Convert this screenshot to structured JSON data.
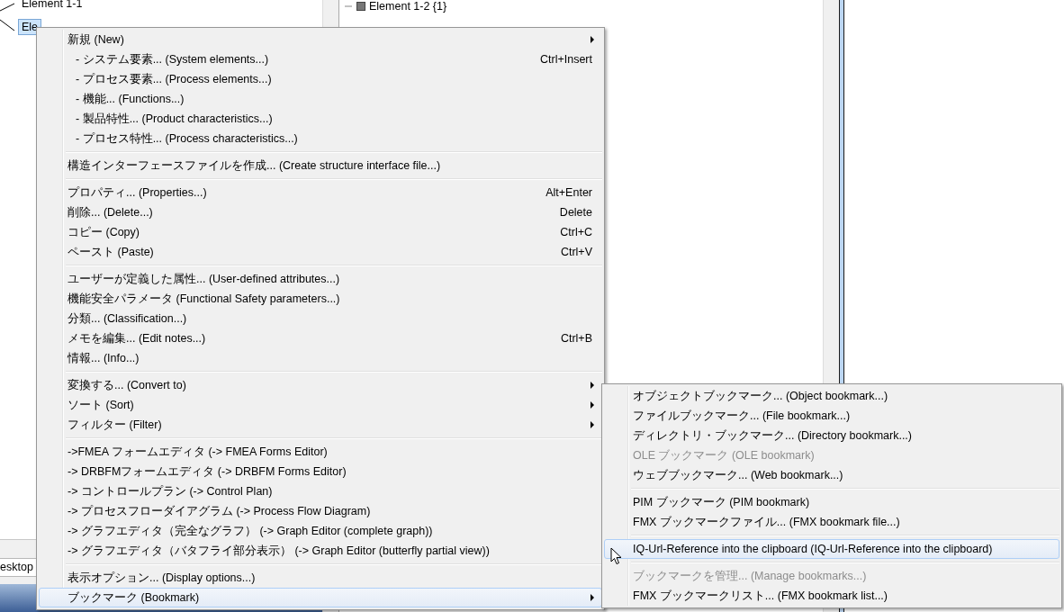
{
  "tree": {
    "items": [
      {
        "label": "Element 1-1",
        "selected": false
      },
      {
        "label": "Ele",
        "selected": true
      }
    ]
  },
  "detail": {
    "items": [
      {
        "label": "Element 1-2 {1}",
        "expanded": true
      }
    ]
  },
  "bottom_tab": {
    "label": "esktop"
  },
  "context_menu": {
    "items": [
      {
        "kind": "item",
        "label": "新規 (New)",
        "has_submenu": true,
        "disabled": false,
        "selected": false
      },
      {
        "kind": "subitem",
        "label": "- システム要素... (System elements...)",
        "shortcut": "Ctrl+Insert",
        "has_submenu": false,
        "disabled": false,
        "selected": false
      },
      {
        "kind": "subitem",
        "label": "- プロセス要素... (Process elements...)",
        "has_submenu": false,
        "disabled": false,
        "selected": false
      },
      {
        "kind": "subitem",
        "label": "- 機能... (Functions...)",
        "has_submenu": false,
        "disabled": false,
        "selected": false
      },
      {
        "kind": "subitem",
        "label": "- 製品特性... (Product characteristics...)",
        "has_submenu": false,
        "disabled": false,
        "selected": false
      },
      {
        "kind": "subitem",
        "label": "- プロセス特性... (Process characteristics...)",
        "has_submenu": false,
        "disabled": false,
        "selected": false
      },
      {
        "kind": "separator"
      },
      {
        "kind": "item",
        "label": "構造インターフェースファイルを作成... (Create structure interface file...)",
        "has_submenu": false,
        "disabled": false,
        "selected": false
      },
      {
        "kind": "separator"
      },
      {
        "kind": "item",
        "label": "プロパティ... (Properties...)",
        "shortcut": "Alt+Enter",
        "has_submenu": false,
        "disabled": false,
        "selected": false
      },
      {
        "kind": "item",
        "label": "削除... (Delete...)",
        "shortcut": "Delete",
        "has_submenu": false,
        "disabled": false,
        "selected": false
      },
      {
        "kind": "item",
        "label": "コピー (Copy)",
        "shortcut": "Ctrl+C",
        "has_submenu": false,
        "disabled": false,
        "selected": false
      },
      {
        "kind": "item",
        "label": "ペースト (Paste)",
        "shortcut": "Ctrl+V",
        "has_submenu": false,
        "disabled": false,
        "selected": false
      },
      {
        "kind": "separator"
      },
      {
        "kind": "item",
        "label": "ユーザーが定義した属性... (User-defined attributes...)",
        "has_submenu": false,
        "disabled": false,
        "selected": false
      },
      {
        "kind": "item",
        "label": "機能安全パラメータ (Functional Safety parameters...)",
        "has_submenu": false,
        "disabled": false,
        "selected": false
      },
      {
        "kind": "item",
        "label": "分類... (Classification...)",
        "has_submenu": false,
        "disabled": false,
        "selected": false
      },
      {
        "kind": "item",
        "label": "メモを編集... (Edit notes...)",
        "shortcut": "Ctrl+B",
        "has_submenu": false,
        "disabled": false,
        "selected": false
      },
      {
        "kind": "item",
        "label": "情報... (Info...)",
        "has_submenu": false,
        "disabled": false,
        "selected": false
      },
      {
        "kind": "separator"
      },
      {
        "kind": "item",
        "label": "変換する... (Convert to)",
        "has_submenu": true,
        "disabled": false,
        "selected": false
      },
      {
        "kind": "item",
        "label": "ソート (Sort)",
        "has_submenu": true,
        "disabled": false,
        "selected": false
      },
      {
        "kind": "item",
        "label": "フィルター (Filter)",
        "has_submenu": true,
        "disabled": false,
        "selected": false
      },
      {
        "kind": "separator"
      },
      {
        "kind": "item",
        "label": "->FMEA フォームエディタ (-> FMEA Forms Editor)",
        "has_submenu": false,
        "disabled": false,
        "selected": false
      },
      {
        "kind": "item",
        "label": "-> DRBFMフォームエディタ (-> DRBFM Forms Editor)",
        "has_submenu": false,
        "disabled": false,
        "selected": false
      },
      {
        "kind": "item",
        "label": "-> コントロールプラン (-> Control Plan)",
        "has_submenu": false,
        "disabled": false,
        "selected": false
      },
      {
        "kind": "item",
        "label": "-> プロセスフローダイアグラム (-> Process Flow Diagram)",
        "has_submenu": false,
        "disabled": false,
        "selected": false
      },
      {
        "kind": "item",
        "label": "-> グラフエディタ（完全なグラフ） (-> Graph Editor (complete graph))",
        "has_submenu": false,
        "disabled": false,
        "selected": false
      },
      {
        "kind": "item",
        "label": "-> グラフエディタ（バタフライ部分表示） (-> Graph Editor (butterfly partial view))",
        "has_submenu": false,
        "disabled": false,
        "selected": false
      },
      {
        "kind": "separator"
      },
      {
        "kind": "item",
        "label": "表示オプション... (Display options...)",
        "has_submenu": false,
        "disabled": false,
        "selected": false
      },
      {
        "kind": "item",
        "label": "ブックマーク (Bookmark)",
        "has_submenu": true,
        "disabled": false,
        "selected": true
      }
    ]
  },
  "submenu": {
    "items": [
      {
        "kind": "item",
        "label": "オブジェクトブックマーク... (Object bookmark...)",
        "disabled": false,
        "selected": false
      },
      {
        "kind": "item",
        "label": "ファイルブックマーク... (File bookmark...)",
        "disabled": false,
        "selected": false
      },
      {
        "kind": "item",
        "label": "ディレクトリ・ブックマーク... (Directory bookmark...)",
        "disabled": false,
        "selected": false
      },
      {
        "kind": "item",
        "label": "OLE ブックマーク (OLE bookmark)",
        "disabled": true,
        "selected": false
      },
      {
        "kind": "item",
        "label": "ウェブブックマーク... (Web bookmark...)",
        "disabled": false,
        "selected": false
      },
      {
        "kind": "separator"
      },
      {
        "kind": "item",
        "label": "PIM ブックマーク (PIM bookmark)",
        "disabled": false,
        "selected": false
      },
      {
        "kind": "item",
        "label": "FMX ブックマークファイル... (FMX bookmark file...)",
        "disabled": false,
        "selected": false
      },
      {
        "kind": "separator"
      },
      {
        "kind": "item",
        "label": "IQ-Url-Reference into the clipboard (IQ-Url-Reference into the clipboard)",
        "disabled": false,
        "selected": true
      },
      {
        "kind": "separator"
      },
      {
        "kind": "item",
        "label": "ブックマークを管理... (Manage bookmarks...)",
        "disabled": true,
        "selected": false
      },
      {
        "kind": "item",
        "label": "FMX ブックマークリスト... (FMX bookmark list...)",
        "disabled": false,
        "selected": false
      }
    ]
  }
}
